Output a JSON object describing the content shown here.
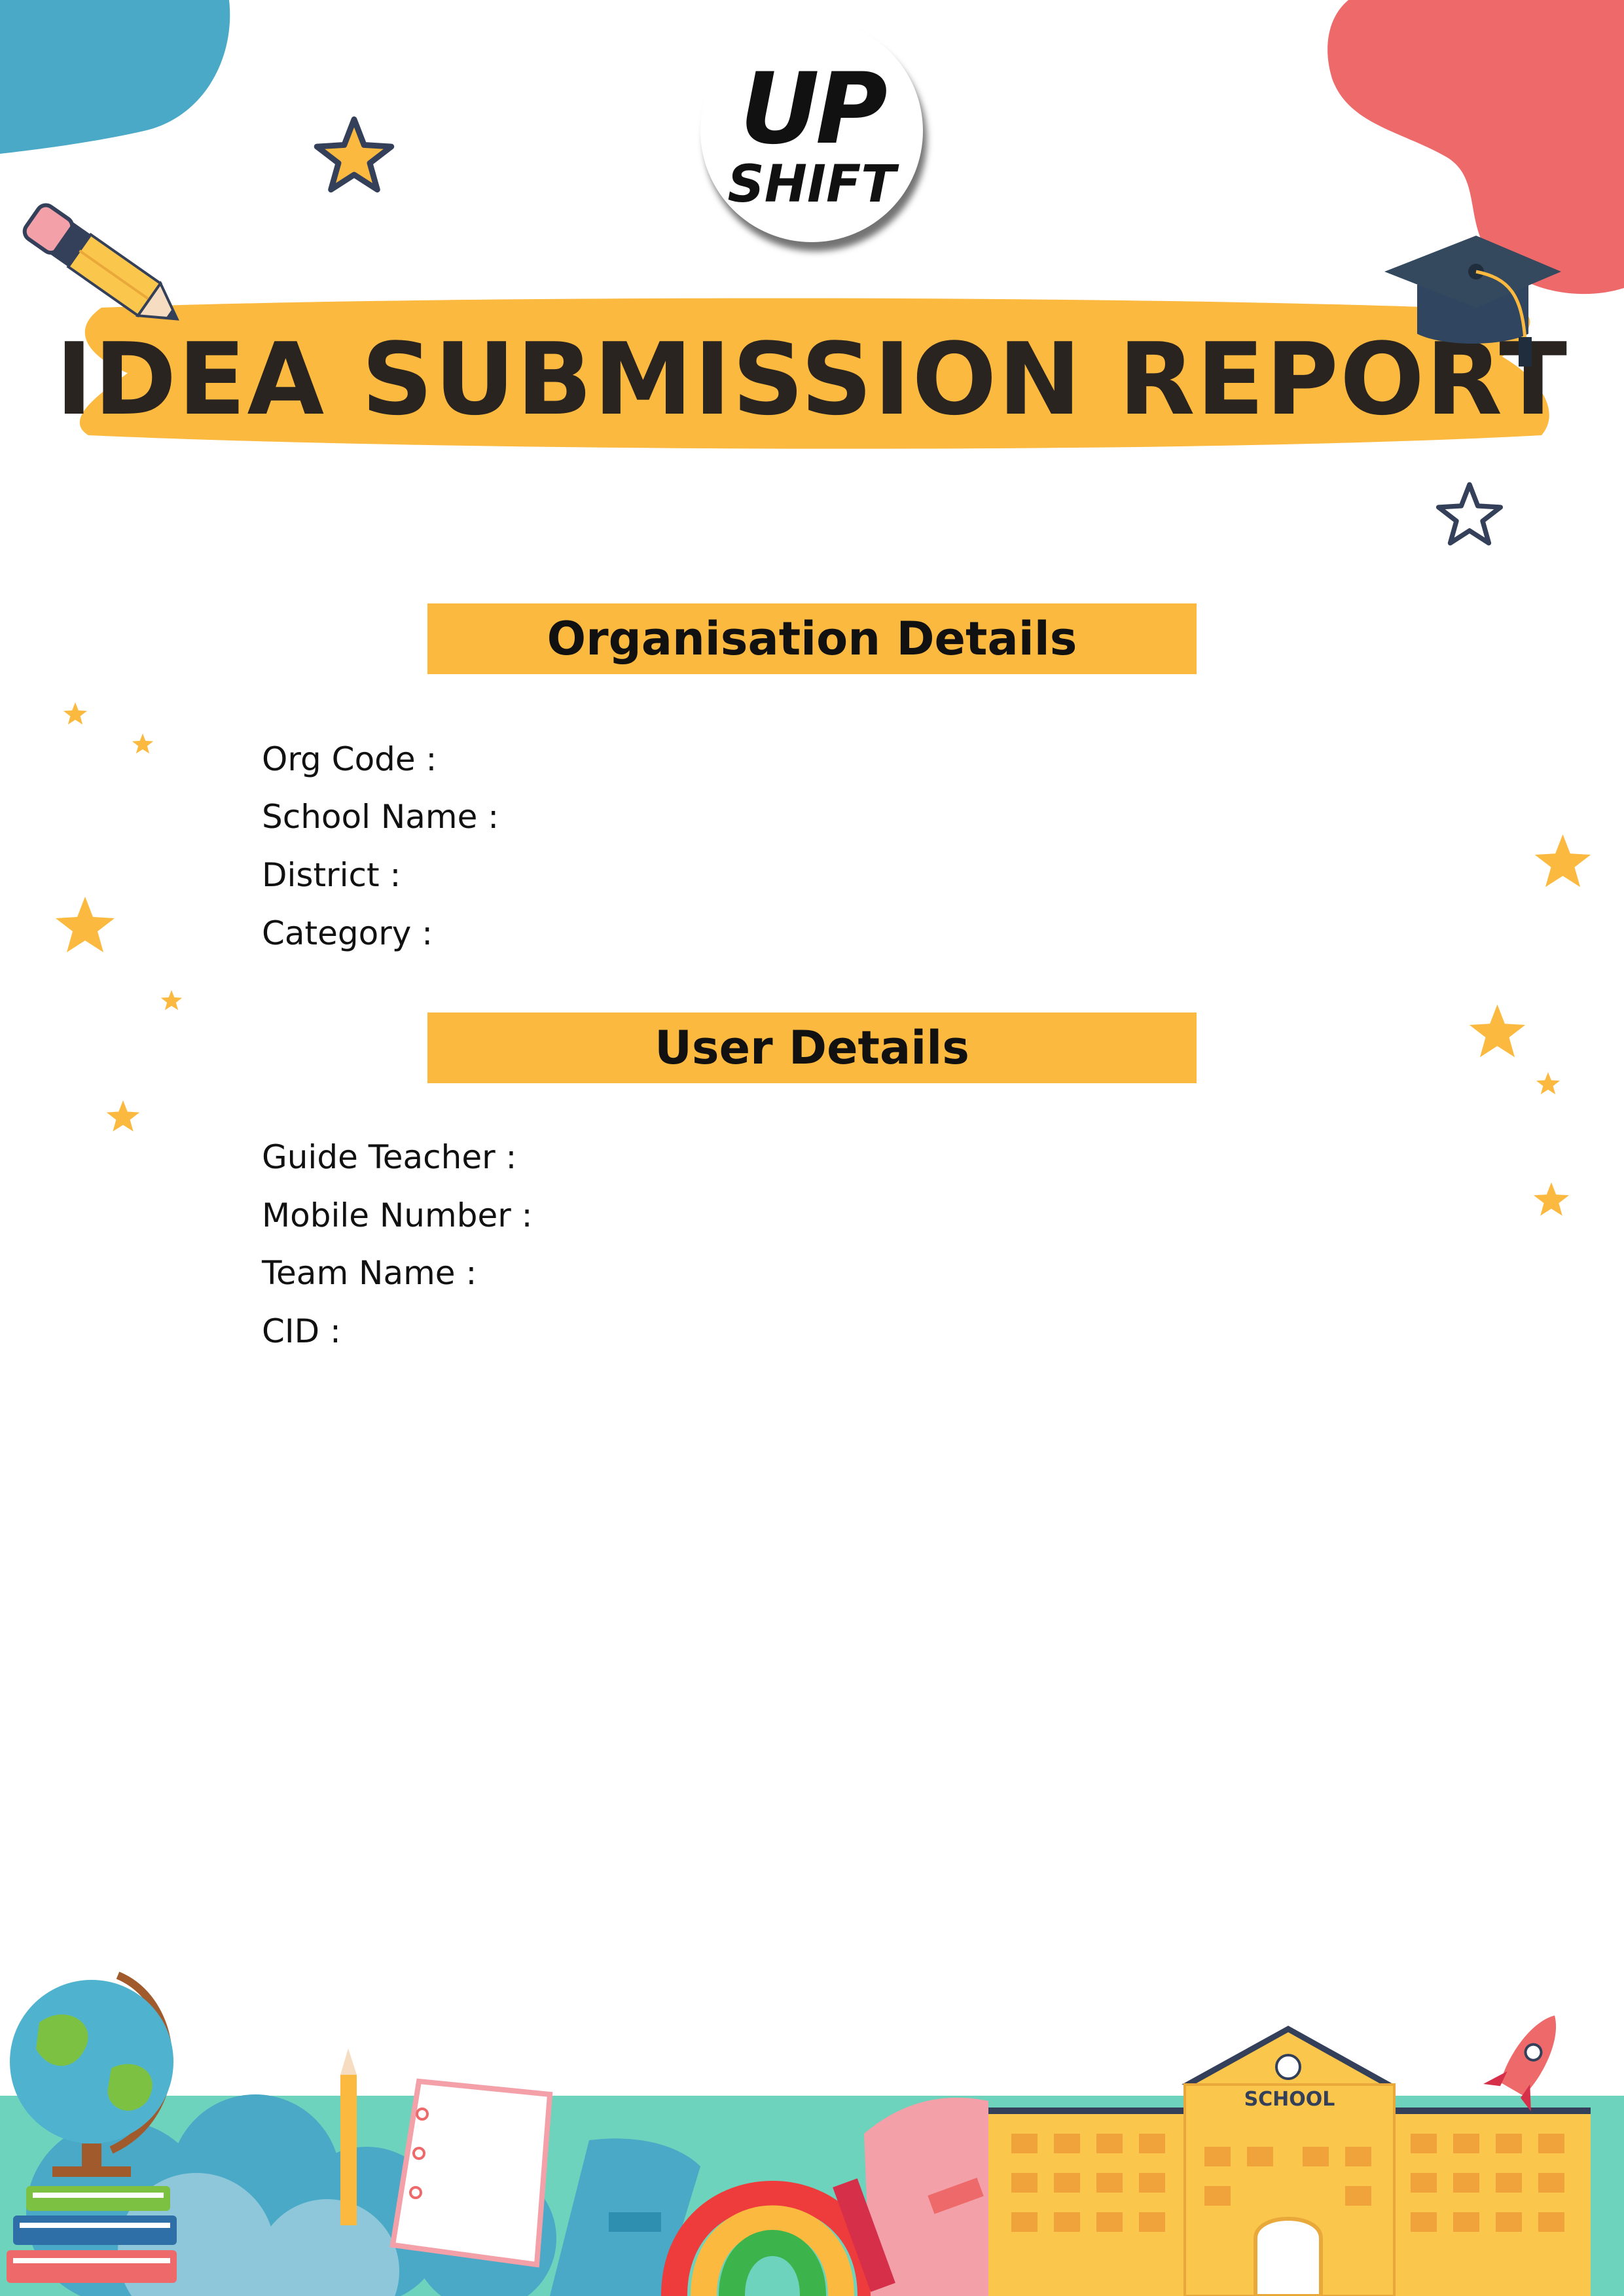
{
  "logo": {
    "line1": "UP",
    "line2": "SHIFT"
  },
  "title": "IDEA SUBMISSION REPORT",
  "organisation": {
    "heading": "Organisation Details",
    "fields": [
      {
        "label": "Org Code :",
        "value": ""
      },
      {
        "label": "School Name :",
        "value": ""
      },
      {
        "label": "District :",
        "value": ""
      },
      {
        "label": "Category :",
        "value": ""
      }
    ]
  },
  "user": {
    "heading": "User Details",
    "fields": [
      {
        "label": "Guide Teacher :",
        "value": ""
      },
      {
        "label": "Mobile Number :",
        "value": ""
      },
      {
        "label": "Team Name :",
        "value": ""
      },
      {
        "label": "CID :",
        "value": ""
      }
    ]
  },
  "footer": {
    "school_sign": "SCHOOL"
  },
  "colors": {
    "accent": "#fbb93f",
    "blue_blob": "#4aa9c7",
    "red_blob": "#ee6a6a",
    "teal_ground": "#6ed3bd",
    "text": "#111111"
  }
}
